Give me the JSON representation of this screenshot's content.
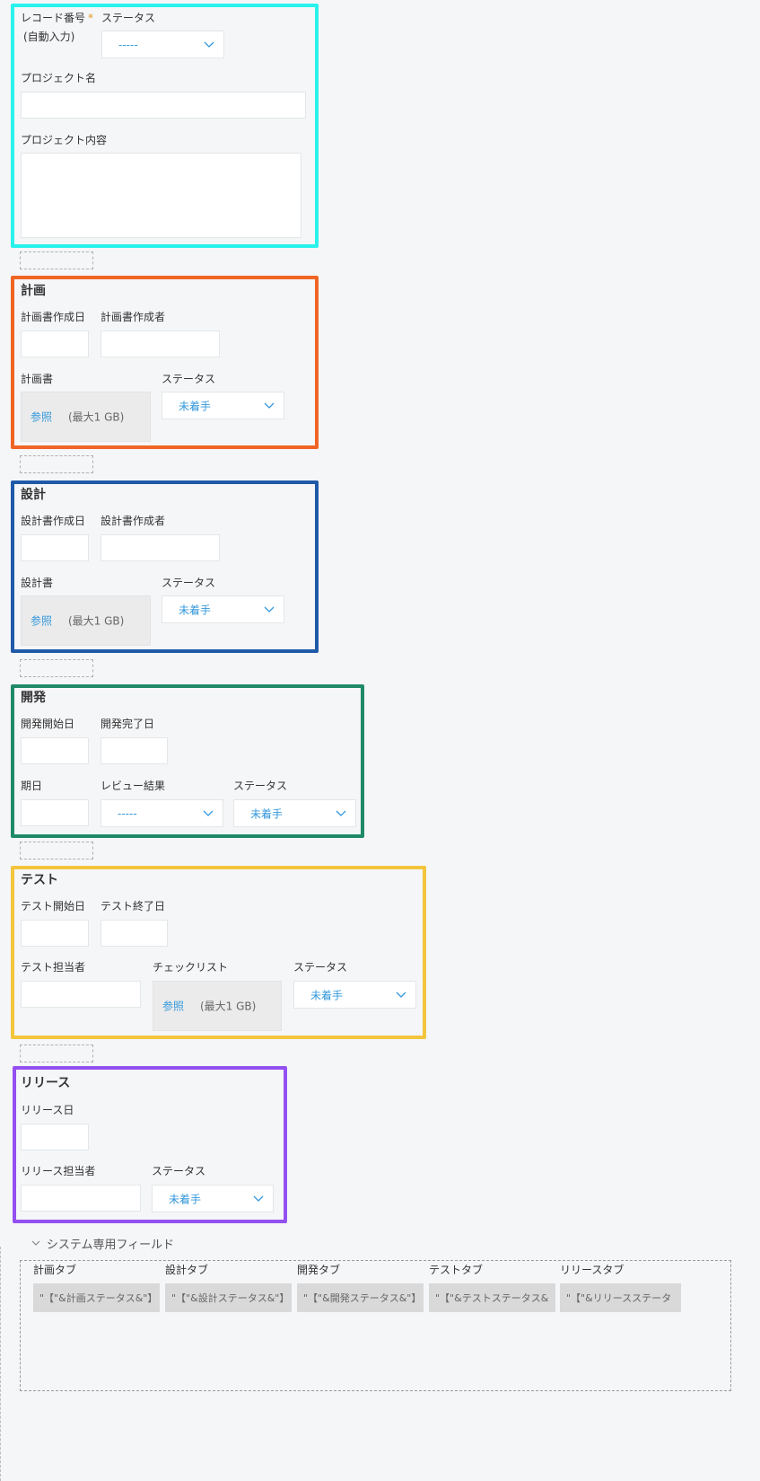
{
  "colors": {
    "section1": "#28f2ec",
    "plan": "#f06524",
    "design": "#1f5aa8",
    "dev": "#1f8a67",
    "test": "#f2c53d",
    "release": "#9450f0",
    "link": "#3498db",
    "required": "#e49722"
  },
  "icons": {
    "dropdown": "chevron-down-icon",
    "collapse": "chevron-down-icon"
  },
  "basic": {
    "record_label": "レコード番号",
    "required_mark": "*",
    "record_value": "(自動入力)",
    "status_label": "ステータス",
    "status_value": "-----",
    "project_name_label": "プロジェクト名",
    "project_content_label": "プロジェクト内容"
  },
  "plan": {
    "title": "計画",
    "date_label": "計画書作成日",
    "author_label": "計画書作成者",
    "doc_label": "計画書",
    "browse": "参照",
    "max": "(最大1 GB)",
    "status_label": "ステータス",
    "status_value": "未着手"
  },
  "design": {
    "title": "設計",
    "date_label": "設計書作成日",
    "author_label": "設計書作成者",
    "doc_label": "設計書",
    "browse": "参照",
    "max": "(最大1 GB)",
    "status_label": "ステータス",
    "status_value": "未着手"
  },
  "dev": {
    "title": "開発",
    "start_label": "開発開始日",
    "end_label": "開発完了日",
    "due_label": "期日",
    "review_label": "レビュー結果",
    "review_value": "-----",
    "status_label": "ステータス",
    "status_value": "未着手"
  },
  "test": {
    "title": "テスト",
    "start_label": "テスト開始日",
    "end_label": "テスト終了日",
    "owner_label": "テスト担当者",
    "checklist_label": "チェックリスト",
    "browse": "参照",
    "max": "(最大1 GB)",
    "status_label": "ステータス",
    "status_value": "未着手"
  },
  "release": {
    "title": "リリース",
    "date_label": "リリース日",
    "owner_label": "リリース担当者",
    "status_label": "ステータス",
    "status_value": "未着手"
  },
  "system": {
    "toggle_label": "システム専用フィールド",
    "fields": [
      {
        "label": "計画タブ",
        "value": "\"【\"&計画ステータス&\"】"
      },
      {
        "label": "設計タブ",
        "value": "\"【\"&設計ステータス&\"】"
      },
      {
        "label": "開発タブ",
        "value": "\"【\"&開発ステータス&\"】"
      },
      {
        "label": "テストタブ",
        "value": "\"【\"&テストステータス&"
      },
      {
        "label": "リリースタブ",
        "value": "\"【\"&リリースステータ"
      }
    ]
  }
}
